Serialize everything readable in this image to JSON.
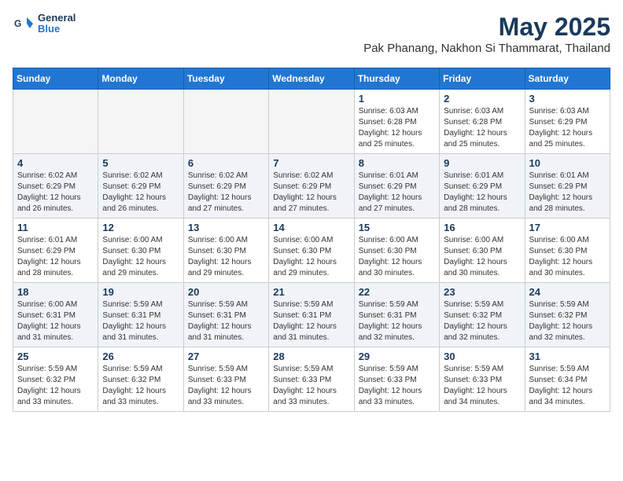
{
  "header": {
    "logo_line1": "General",
    "logo_line2": "Blue",
    "title": "May 2025",
    "subtitle": "Pak Phanang, Nakhon Si Thammarat, Thailand"
  },
  "calendar": {
    "columns": [
      "Sunday",
      "Monday",
      "Tuesday",
      "Wednesday",
      "Thursday",
      "Friday",
      "Saturday"
    ],
    "weeks": [
      [
        {
          "day": "",
          "info": ""
        },
        {
          "day": "",
          "info": ""
        },
        {
          "day": "",
          "info": ""
        },
        {
          "day": "",
          "info": ""
        },
        {
          "day": "1",
          "info": "Sunrise: 6:03 AM\nSunset: 6:28 PM\nDaylight: 12 hours\nand 25 minutes."
        },
        {
          "day": "2",
          "info": "Sunrise: 6:03 AM\nSunset: 6:28 PM\nDaylight: 12 hours\nand 25 minutes."
        },
        {
          "day": "3",
          "info": "Sunrise: 6:03 AM\nSunset: 6:29 PM\nDaylight: 12 hours\nand 25 minutes."
        }
      ],
      [
        {
          "day": "4",
          "info": "Sunrise: 6:02 AM\nSunset: 6:29 PM\nDaylight: 12 hours\nand 26 minutes."
        },
        {
          "day": "5",
          "info": "Sunrise: 6:02 AM\nSunset: 6:29 PM\nDaylight: 12 hours\nand 26 minutes."
        },
        {
          "day": "6",
          "info": "Sunrise: 6:02 AM\nSunset: 6:29 PM\nDaylight: 12 hours\nand 27 minutes."
        },
        {
          "day": "7",
          "info": "Sunrise: 6:02 AM\nSunset: 6:29 PM\nDaylight: 12 hours\nand 27 minutes."
        },
        {
          "day": "8",
          "info": "Sunrise: 6:01 AM\nSunset: 6:29 PM\nDaylight: 12 hours\nand 27 minutes."
        },
        {
          "day": "9",
          "info": "Sunrise: 6:01 AM\nSunset: 6:29 PM\nDaylight: 12 hours\nand 28 minutes."
        },
        {
          "day": "10",
          "info": "Sunrise: 6:01 AM\nSunset: 6:29 PM\nDaylight: 12 hours\nand 28 minutes."
        }
      ],
      [
        {
          "day": "11",
          "info": "Sunrise: 6:01 AM\nSunset: 6:29 PM\nDaylight: 12 hours\nand 28 minutes."
        },
        {
          "day": "12",
          "info": "Sunrise: 6:00 AM\nSunset: 6:30 PM\nDaylight: 12 hours\nand 29 minutes."
        },
        {
          "day": "13",
          "info": "Sunrise: 6:00 AM\nSunset: 6:30 PM\nDaylight: 12 hours\nand 29 minutes."
        },
        {
          "day": "14",
          "info": "Sunrise: 6:00 AM\nSunset: 6:30 PM\nDaylight: 12 hours\nand 29 minutes."
        },
        {
          "day": "15",
          "info": "Sunrise: 6:00 AM\nSunset: 6:30 PM\nDaylight: 12 hours\nand 30 minutes."
        },
        {
          "day": "16",
          "info": "Sunrise: 6:00 AM\nSunset: 6:30 PM\nDaylight: 12 hours\nand 30 minutes."
        },
        {
          "day": "17",
          "info": "Sunrise: 6:00 AM\nSunset: 6:30 PM\nDaylight: 12 hours\nand 30 minutes."
        }
      ],
      [
        {
          "day": "18",
          "info": "Sunrise: 6:00 AM\nSunset: 6:31 PM\nDaylight: 12 hours\nand 31 minutes."
        },
        {
          "day": "19",
          "info": "Sunrise: 5:59 AM\nSunset: 6:31 PM\nDaylight: 12 hours\nand 31 minutes."
        },
        {
          "day": "20",
          "info": "Sunrise: 5:59 AM\nSunset: 6:31 PM\nDaylight: 12 hours\nand 31 minutes."
        },
        {
          "day": "21",
          "info": "Sunrise: 5:59 AM\nSunset: 6:31 PM\nDaylight: 12 hours\nand 31 minutes."
        },
        {
          "day": "22",
          "info": "Sunrise: 5:59 AM\nSunset: 6:31 PM\nDaylight: 12 hours\nand 32 minutes."
        },
        {
          "day": "23",
          "info": "Sunrise: 5:59 AM\nSunset: 6:32 PM\nDaylight: 12 hours\nand 32 minutes."
        },
        {
          "day": "24",
          "info": "Sunrise: 5:59 AM\nSunset: 6:32 PM\nDaylight: 12 hours\nand 32 minutes."
        }
      ],
      [
        {
          "day": "25",
          "info": "Sunrise: 5:59 AM\nSunset: 6:32 PM\nDaylight: 12 hours\nand 33 minutes."
        },
        {
          "day": "26",
          "info": "Sunrise: 5:59 AM\nSunset: 6:32 PM\nDaylight: 12 hours\nand 33 minutes."
        },
        {
          "day": "27",
          "info": "Sunrise: 5:59 AM\nSunset: 6:33 PM\nDaylight: 12 hours\nand 33 minutes."
        },
        {
          "day": "28",
          "info": "Sunrise: 5:59 AM\nSunset: 6:33 PM\nDaylight: 12 hours\nand 33 minutes."
        },
        {
          "day": "29",
          "info": "Sunrise: 5:59 AM\nSunset: 6:33 PM\nDaylight: 12 hours\nand 33 minutes."
        },
        {
          "day": "30",
          "info": "Sunrise: 5:59 AM\nSunset: 6:33 PM\nDaylight: 12 hours\nand 34 minutes."
        },
        {
          "day": "31",
          "info": "Sunrise: 5:59 AM\nSunset: 6:34 PM\nDaylight: 12 hours\nand 34 minutes."
        }
      ]
    ]
  }
}
